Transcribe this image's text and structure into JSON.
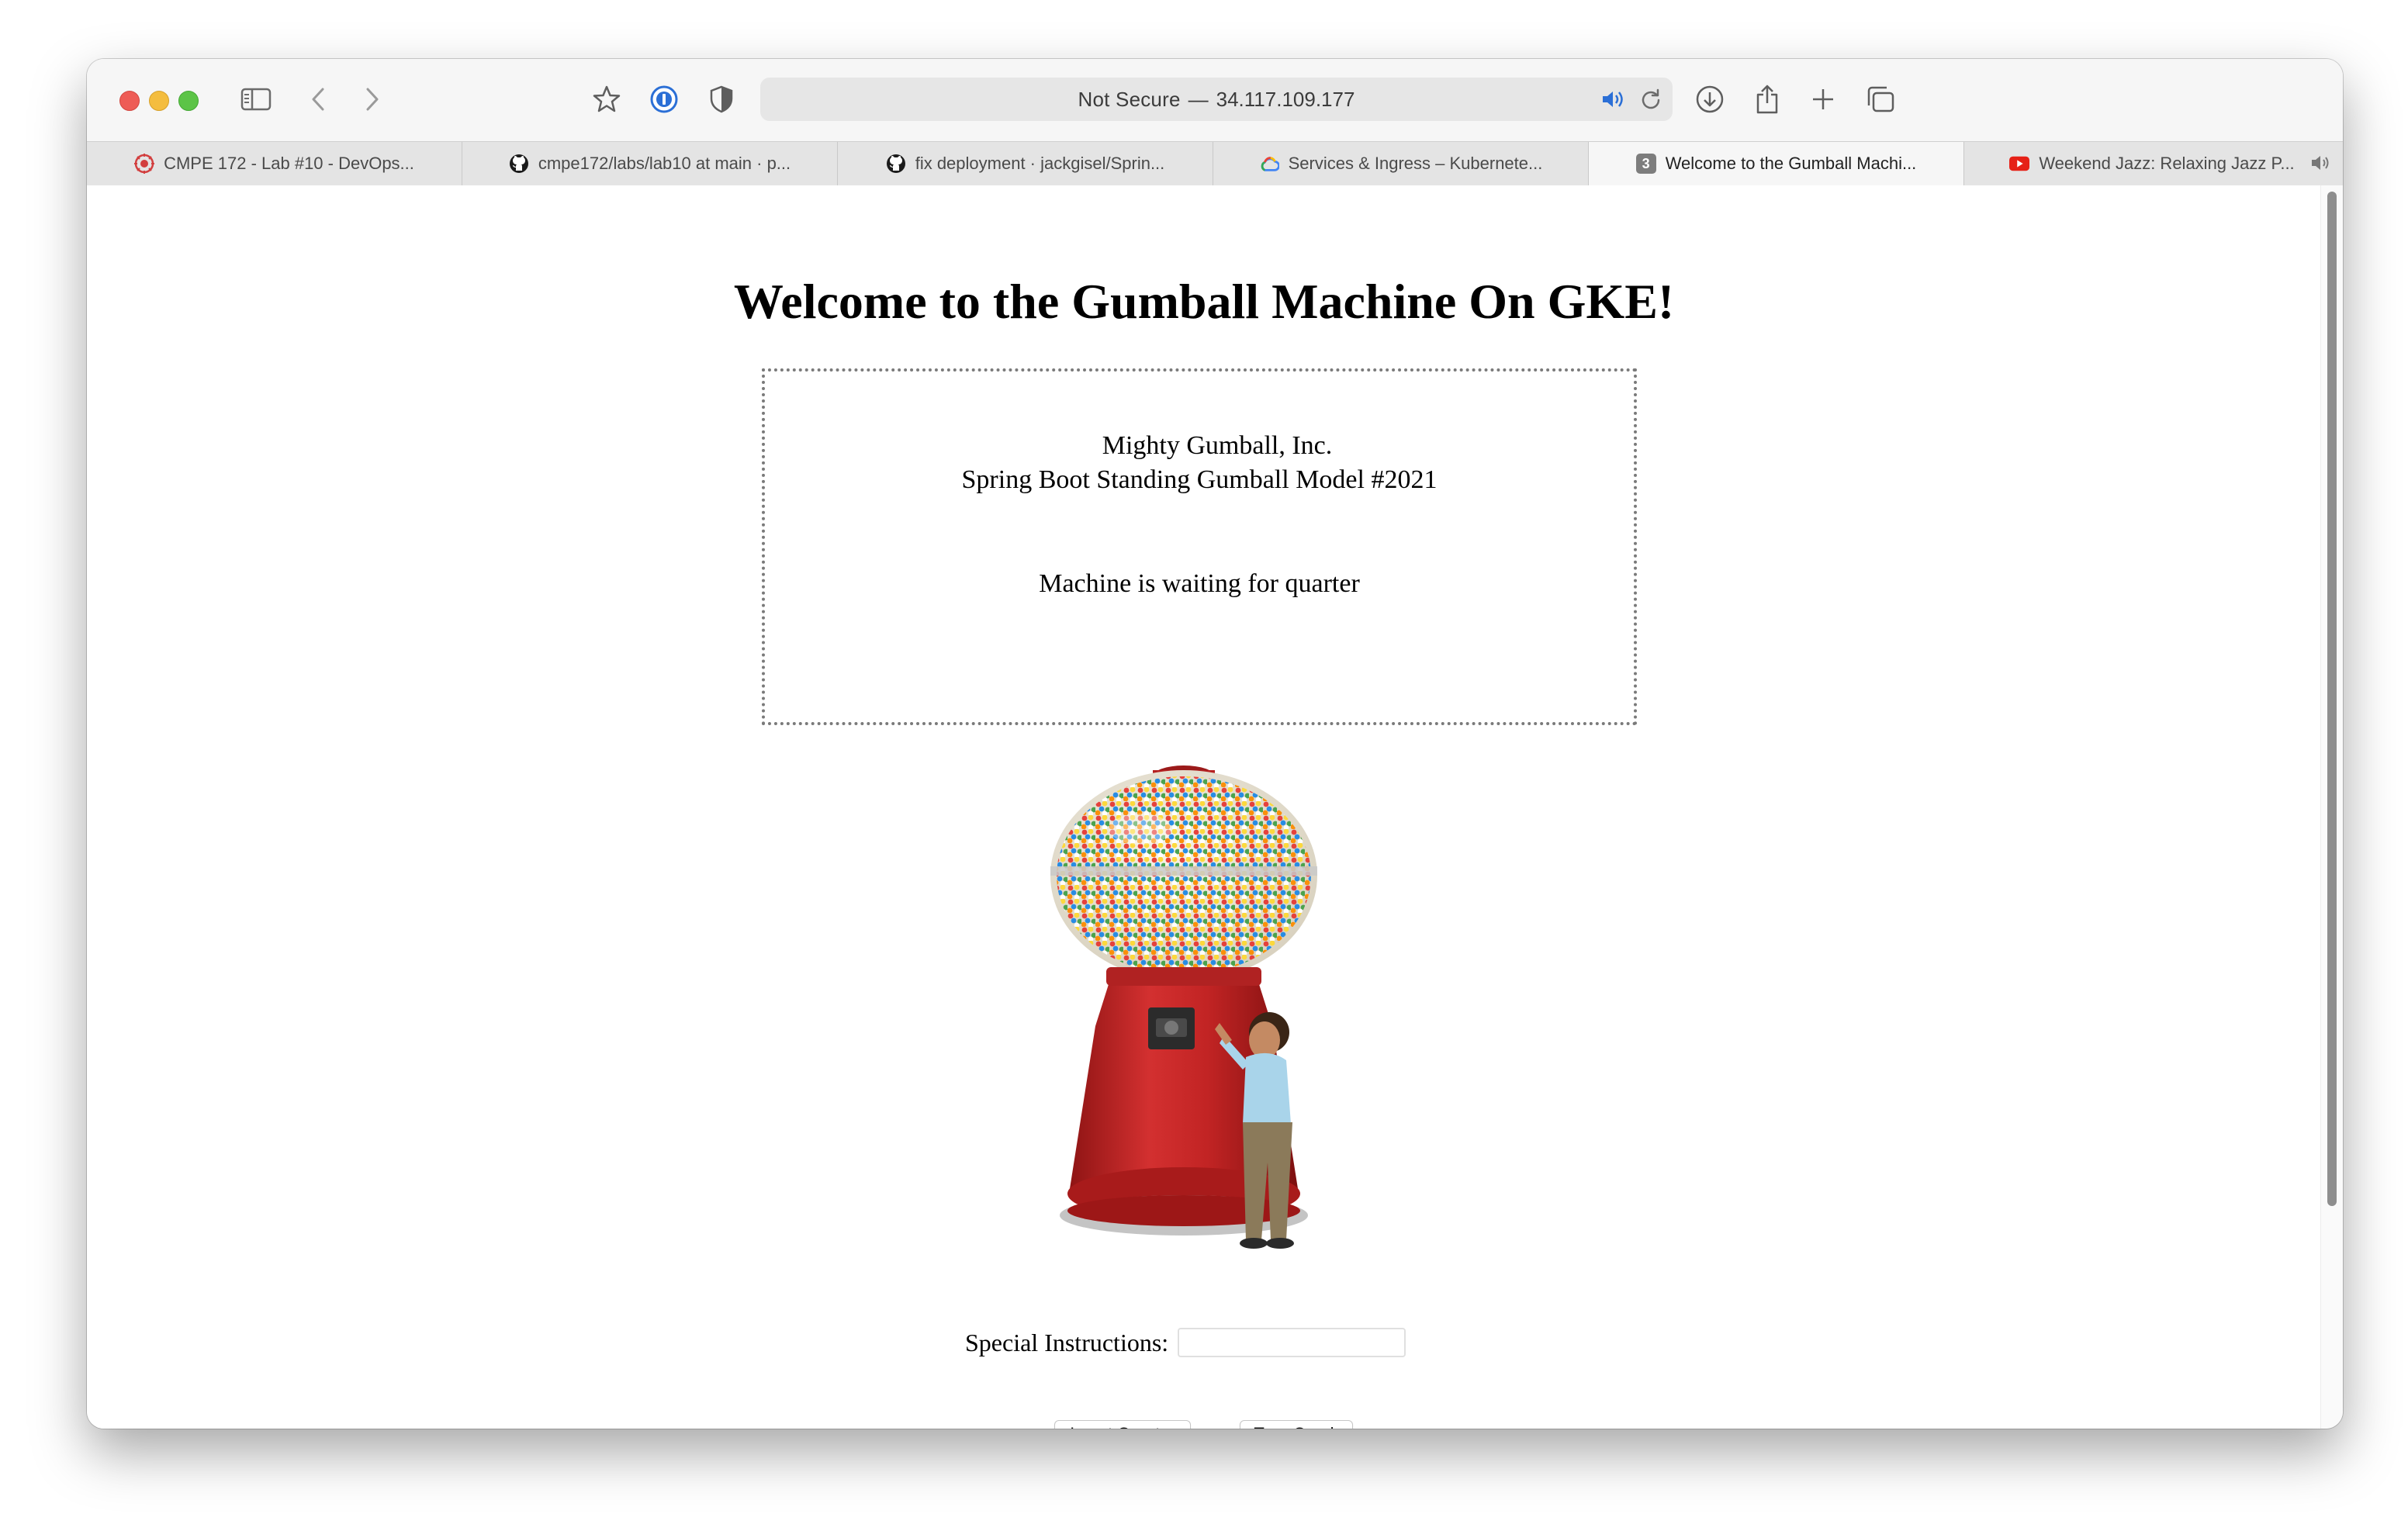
{
  "browser": {
    "address": {
      "security_label": "Not Secure",
      "separator": "—",
      "host": "34.117.109.177"
    },
    "tabs": [
      {
        "label": "CMPE 172 - Lab #10 - DevOps...",
        "icon": "sjsu-icon",
        "active": false
      },
      {
        "label": "cmpe172/labs/lab10 at main · p...",
        "icon": "github-icon",
        "active": false
      },
      {
        "label": "fix deployment · jackgisel/Sprin...",
        "icon": "github-icon",
        "active": false
      },
      {
        "label": "Services & Ingress – Kubernete...",
        "icon": "google-cloud-icon",
        "active": false
      },
      {
        "label": "Welcome to the Gumball Machi...",
        "icon": "number-3-icon",
        "badge": "3",
        "active": true
      },
      {
        "label": "Weekend Jazz: Relaxing Jazz P...",
        "icon": "youtube-icon",
        "active": false,
        "audio": true
      }
    ]
  },
  "page": {
    "title": "Welcome to the Gumball Machine On GKE!",
    "company": "Mighty Gumball, Inc.",
    "model": "Spring Boot Standing Gumball Model #2021",
    "state": "Machine is waiting for quarter",
    "instructions_label": "Special Instructions:",
    "instructions_value": "",
    "insert_quarter_label": "Insert Quarter",
    "turn_crank_label": "Turn Crank"
  },
  "colors": {
    "machine_red": "#c8262a",
    "close": "#ee5c56",
    "minimize": "#f4bd3e",
    "maximize": "#5cc447"
  }
}
